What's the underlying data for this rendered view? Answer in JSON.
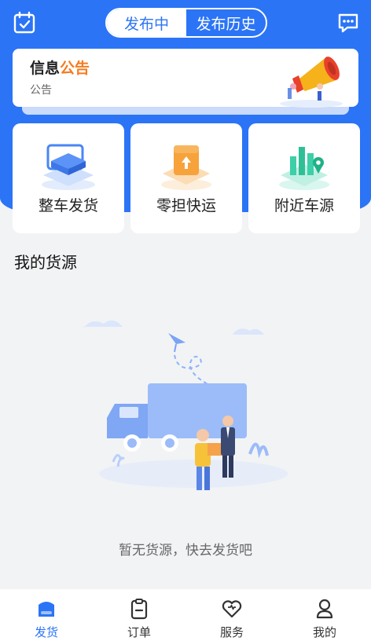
{
  "header": {
    "segments": [
      {
        "label": "发布中",
        "active": true
      },
      {
        "label": "发布历史",
        "active": false
      }
    ],
    "left_icon": "calendar-check-icon",
    "right_icon": "message-icon"
  },
  "notice": {
    "title_prefix": "信息",
    "title_highlight": "公告",
    "subtitle": "公告"
  },
  "services": [
    {
      "label": "整车发货",
      "icon": "full-truck-icon"
    },
    {
      "label": "零担快运",
      "icon": "less-than-truckload-icon"
    },
    {
      "label": "附近车源",
      "icon": "nearby-vehicle-icon"
    }
  ],
  "section": {
    "title": "我的货源"
  },
  "empty": {
    "message": "暂无货源，快去发货吧"
  },
  "tabbar": {
    "items": [
      {
        "label": "发货",
        "icon": "ship-cargo-icon",
        "active": true
      },
      {
        "label": "订单",
        "icon": "order-clipboard-icon",
        "active": false
      },
      {
        "label": "服务",
        "icon": "heart-icon",
        "active": false
      },
      {
        "label": "我的",
        "icon": "user-icon",
        "active": false
      }
    ]
  },
  "colors": {
    "primary": "#2b74f6",
    "accent_orange": "#f57b1f",
    "background": "#f2f3f5"
  }
}
